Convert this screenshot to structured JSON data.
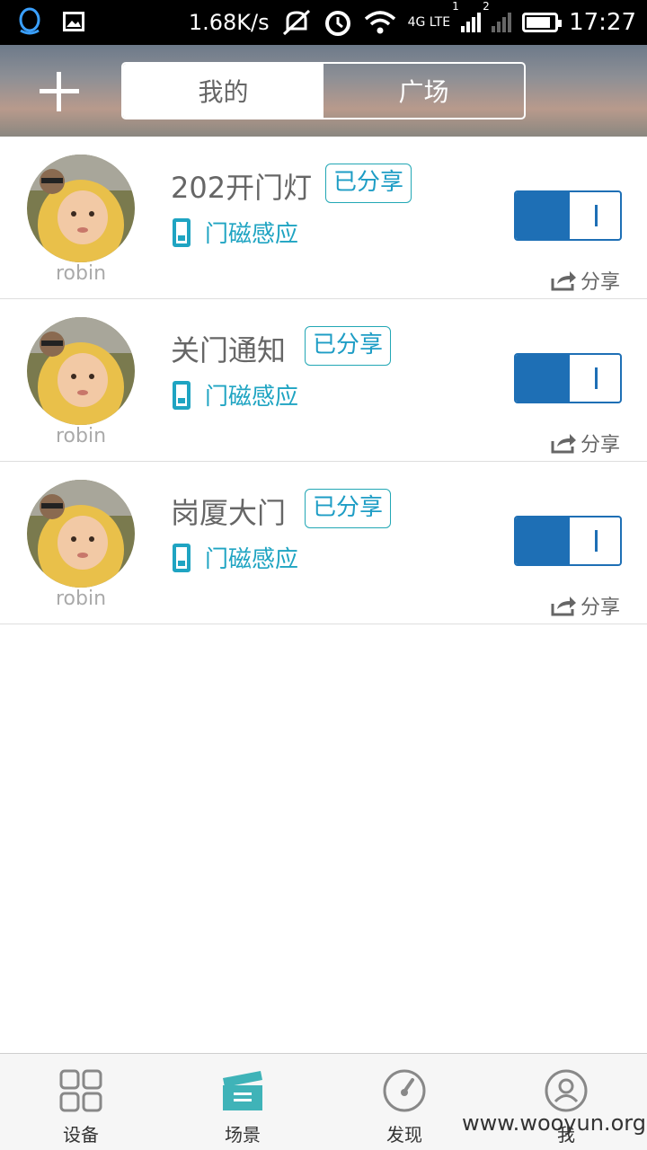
{
  "status_bar": {
    "speed": "1.68K/s",
    "network_label": "4G LTE",
    "sim1": "1",
    "sim2": "2",
    "time": "17:27"
  },
  "header": {
    "tabs": [
      {
        "label": "我的",
        "active": true
      },
      {
        "label": "广场",
        "active": false
      }
    ]
  },
  "scenes": [
    {
      "title": "202开门灯",
      "badge": "已分享",
      "trigger": "门磁感应",
      "owner": "robin",
      "enabled": true,
      "share_label": "分享"
    },
    {
      "title": "关门通知",
      "badge": "已分享",
      "trigger": "门磁感应",
      "owner": "robin",
      "enabled": true,
      "share_label": "分享"
    },
    {
      "title": "岗厦大门",
      "badge": "已分享",
      "trigger": "门磁感应",
      "owner": "robin",
      "enabled": true,
      "share_label": "分享"
    }
  ],
  "tabbar": {
    "items": [
      {
        "label": "设备",
        "icon": "device-grid-icon",
        "active": false
      },
      {
        "label": "场景",
        "icon": "scene-clapper-icon",
        "active": true
      },
      {
        "label": "发现",
        "icon": "discover-gauge-icon",
        "active": false
      },
      {
        "label": "我",
        "icon": "profile-icon",
        "active": false
      }
    ]
  },
  "watermark": "www.wooyun.org",
  "colors": {
    "accent": "#1e6fb5",
    "teal": "#1fa4c2",
    "active_tab_icon": "#3fb3b8"
  }
}
